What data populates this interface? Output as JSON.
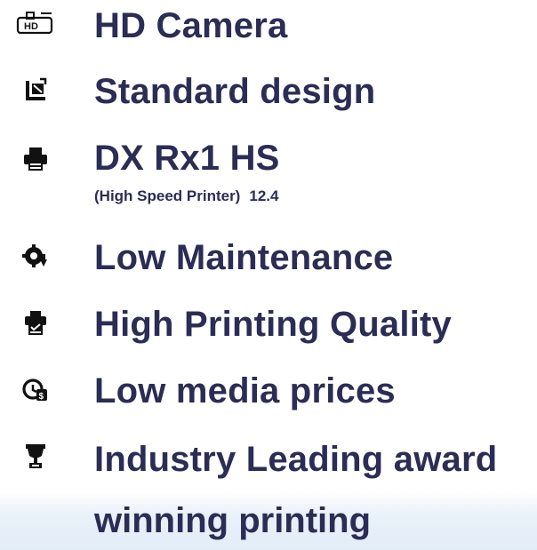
{
  "features": [
    {
      "label": "HD Camera",
      "icon": "hd-camera-icon"
    },
    {
      "label": "Standard design",
      "icon": "design-icon"
    },
    {
      "label": "DX Rx1 HS",
      "sublabel": "(High Speed Printer)",
      "sublabel_value": "12.4",
      "icon": "printer-icon"
    },
    {
      "label": "Low Maintenance",
      "icon": "maintenance-icon"
    },
    {
      "label": "High Printing Quality",
      "icon": "quality-icon"
    },
    {
      "label": "Low media prices",
      "icon": "price-icon"
    },
    {
      "label": "Industry Leading award",
      "continuation": "winning printing",
      "icon": "trophy-icon"
    }
  ],
  "colors": {
    "text": "#2b2d55",
    "icon": "#111111",
    "band": "#e3edf7"
  }
}
